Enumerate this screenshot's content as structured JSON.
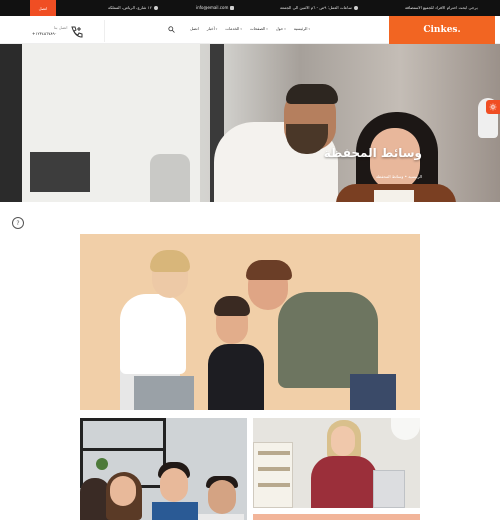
{
  "colors": {
    "accent": "#f04e23",
    "logo_bg": "#f26522",
    "topbar_bg": "#111111"
  },
  "topbar": {
    "cta_label": "اتصل",
    "opening_text": "يرجى ابحث احترام الافراد للجميع الاستضافة",
    "opening_icon": "clock-icon",
    "hours_text": "ساعات العمل: ٩ص - ٦م الاثنين الى الجمعة",
    "hours_icon": "clock-icon",
    "email_text": "info@email.com",
    "email_icon": "envelope-icon",
    "address_text": "١٢ شارع، الرياض، المملكة",
    "address_icon": "map-pin-icon"
  },
  "header": {
    "logo": "Cinkes.",
    "nav": [
      {
        "label": "الرئيسية",
        "caret": "▾"
      },
      {
        "label": "حول",
        "caret": "▾"
      },
      {
        "label": "الصفحات",
        "caret": "▾"
      },
      {
        "label": "الخدمات",
        "caret": "▾"
      },
      {
        "label": "أخبار",
        "caret": "▾"
      },
      {
        "label": "اتصل",
        "caret": ""
      }
    ],
    "search_icon": "search-icon",
    "call_label": "اتصل بنا",
    "call_number": "+١٢٣٤٥٦٧٨٩٠",
    "phone_icon": "phone-icon"
  },
  "hero": {
    "title": "وسائط المحفظة",
    "breadcrumb": "الرئيسية • وسائط المحفظة",
    "settings_icon": "gear-icon"
  },
  "content": {
    "info_icon": "info-icon",
    "info_symbol": "?"
  }
}
